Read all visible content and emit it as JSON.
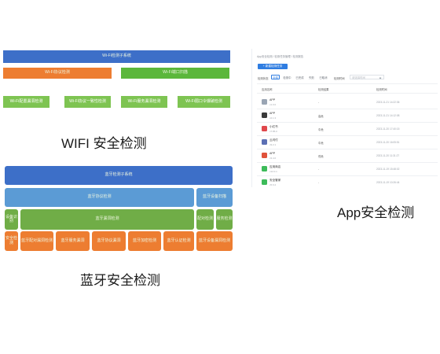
{
  "wifi": {
    "top": "Wi-Fi检测子系统",
    "mid_left": "Wi-Fi协议检测",
    "mid_right": "Wi-Fi端口扫描",
    "modules": [
      "Wi-Fi配置漏洞检测",
      "Wi-Fi协议一致性检测",
      "Wi-Fi服务漏洞检测",
      "Wi-Fi弱口令爆破检测"
    ],
    "caption": "WIFI 安全检测"
  },
  "bluetooth": {
    "top": "蓝牙检测子系统",
    "row2_main": "蓝牙协议检测",
    "row2_side": "蓝牙设备扫描",
    "row3_left": "设备识别",
    "row3_main": "蓝牙漏洞检测",
    "row3_r1": "配对检测",
    "row3_r2": "服务检测",
    "row4_left": "安全检测",
    "row4_items": [
      "蓝牙配对漏洞检测",
      "蓝牙服务漏洞",
      "蓝牙协议漏洞",
      "蓝牙加密检测",
      "蓝牙认证检测"
    ],
    "row4_right": "蓝牙设备漏洞检测",
    "caption": "蓝牙安全检测"
  },
  "app": {
    "caption": "App安全检测",
    "breadcrumb": "App安全检测 / 检测任务管理 / 检测报告",
    "add_button": "+ 新建检测任务",
    "filter_label": "检测状态",
    "tabs": [
      "全部",
      "检测中",
      "已完成",
      "失败",
      "已取消"
    ],
    "search_label": "检测时间",
    "search_placeholder": "请选择时间",
    "columns": [
      "应用名称",
      "检测结果",
      "检测时间"
    ],
    "rows": [
      {
        "name": "APP",
        "sub": "v1.0.0",
        "result": "-",
        "time": "2023-11-21 14:22:36",
        "color": "#9aa5b4"
      },
      {
        "name": "APP",
        "sub": "v2.1.3",
        "result": "高危",
        "time": "2023-11-21 14:12:08",
        "color": "#3a3a3a"
      },
      {
        "name": "小红书",
        "sub": "v7.85.0",
        "result": "中危",
        "time": "2023-11-20 17:40:15",
        "color": "#e0474c"
      },
      {
        "name": "云闪付",
        "sub": "v9.2.1",
        "result": "中危",
        "time": "2023-11-20 16:05:51",
        "color": "#5b6fb4"
      },
      {
        "name": "APP",
        "sub": "v3.4.0",
        "result": "低危",
        "time": "2023-11-20 11:31:27",
        "color": "#e0523a"
      },
      {
        "name": "应用商店",
        "sub": "v12.0.1",
        "result": "-",
        "time": "2023-11-19 15:48:02",
        "color": "#3dbb5a"
      },
      {
        "name": "安全管家",
        "sub": "v5.6.2",
        "result": "-",
        "time": "2023-11-19 10:26:44",
        "color": "#3dbb5a"
      }
    ]
  }
}
